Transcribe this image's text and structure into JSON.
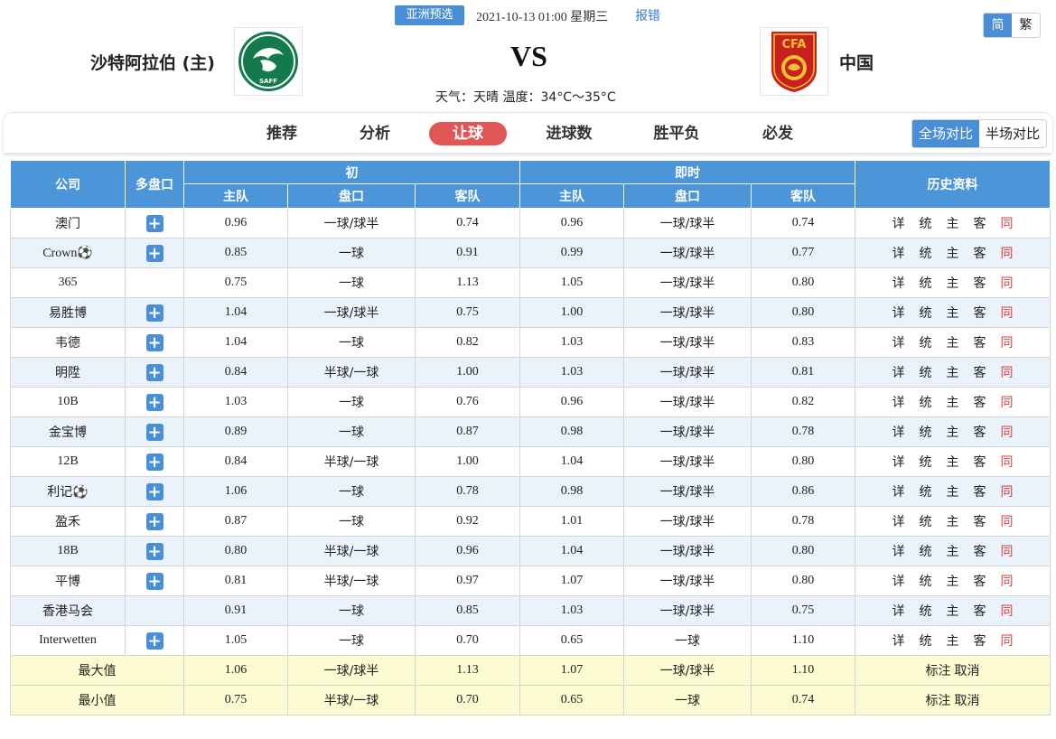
{
  "match": {
    "league": "亚洲预选",
    "datetime": "2021-10-13 01:00 星期三",
    "report": "报错",
    "home": "沙特阿拉伯 (主)",
    "away": "中国",
    "vs": "VS",
    "weather": "天气：天晴  温度：34°C～35°C",
    "home_logo_text": "SAFF",
    "away_logo_text": "CFA"
  },
  "lang": {
    "simplified": "简",
    "traditional": "繁"
  },
  "tabs": [
    "推荐",
    "分析",
    "让球",
    "进球数",
    "胜平负",
    "必发"
  ],
  "active_tab": "让球",
  "compare": {
    "full": "全场对比",
    "half": "半场对比"
  },
  "table": {
    "headers": {
      "company": "公司",
      "multi": "多盘口",
      "initial": "初",
      "live": "即时",
      "history": "历史资料",
      "home": "主队",
      "line": "盘口",
      "away": "客队"
    },
    "history_links": [
      "详",
      "统",
      "主",
      "客",
      "同"
    ],
    "rows": [
      {
        "company": "澳门",
        "plus": true,
        "i_home": "0.96",
        "i_line": "一球/球半",
        "i_away": "0.74",
        "l_home": "0.96",
        "l_line": "一球/球半",
        "l_away": "0.74"
      },
      {
        "company": "Crown⚽",
        "plus": true,
        "i_home": "0.85",
        "i_line": "一球",
        "i_away": "0.91",
        "l_home": "0.99",
        "l_line": "一球/球半",
        "l_away": "0.77"
      },
      {
        "company": "365",
        "plus": false,
        "i_home": "0.75",
        "i_line": "一球",
        "i_away": "1.13",
        "l_home": "1.05",
        "l_line": "一球/球半",
        "l_away": "0.80"
      },
      {
        "company": "易胜博",
        "plus": true,
        "i_home": "1.04",
        "i_line": "一球/球半",
        "i_away": "0.75",
        "l_home": "1.00",
        "l_line": "一球/球半",
        "l_away": "0.80"
      },
      {
        "company": "韦德",
        "plus": true,
        "i_home": "1.04",
        "i_line": "一球",
        "i_away": "0.82",
        "l_home": "1.03",
        "l_line": "一球/球半",
        "l_away": "0.83"
      },
      {
        "company": "明陞",
        "plus": true,
        "i_home": "0.84",
        "i_line": "半球/一球",
        "i_away": "1.00",
        "l_home": "1.03",
        "l_line": "一球/球半",
        "l_away": "0.81"
      },
      {
        "company": "10B",
        "plus": true,
        "i_home": "1.03",
        "i_line": "一球",
        "i_away": "0.76",
        "l_home": "0.96",
        "l_line": "一球/球半",
        "l_away": "0.82"
      },
      {
        "company": "金宝博",
        "plus": true,
        "i_home": "0.89",
        "i_line": "一球",
        "i_away": "0.87",
        "l_home": "0.98",
        "l_line": "一球/球半",
        "l_away": "0.78"
      },
      {
        "company": "12B",
        "plus": true,
        "i_home": "0.84",
        "i_line": "半球/一球",
        "i_away": "1.00",
        "l_home": "1.04",
        "l_line": "一球/球半",
        "l_away": "0.80"
      },
      {
        "company": "利记⚽",
        "plus": true,
        "i_home": "1.06",
        "i_line": "一球",
        "i_away": "0.78",
        "l_home": "0.98",
        "l_line": "一球/球半",
        "l_away": "0.86"
      },
      {
        "company": "盈禾",
        "plus": true,
        "i_home": "0.87",
        "i_line": "一球",
        "i_away": "0.92",
        "l_home": "1.01",
        "l_line": "一球/球半",
        "l_away": "0.78"
      },
      {
        "company": "18B",
        "plus": true,
        "i_home": "0.80",
        "i_line": "半球/一球",
        "i_away": "0.96",
        "l_home": "1.04",
        "l_line": "一球/球半",
        "l_away": "0.80"
      },
      {
        "company": "平博",
        "plus": true,
        "i_home": "0.81",
        "i_line": "半球/一球",
        "i_away": "0.97",
        "l_home": "1.07",
        "l_line": "一球/球半",
        "l_away": "0.80"
      },
      {
        "company": "香港马会",
        "plus": false,
        "i_home": "0.91",
        "i_line": "一球",
        "i_away": "0.85",
        "l_home": "1.03",
        "l_line": "一球/球半",
        "l_away": "0.75"
      },
      {
        "company": "Interwetten",
        "plus": true,
        "i_home": "1.05",
        "i_line": "一球",
        "i_away": "0.70",
        "l_home": "0.65",
        "l_line": "一球",
        "l_away": "1.10"
      }
    ],
    "summary": [
      {
        "label": "最大值",
        "i_home": "1.06",
        "i_line": "一球/球半",
        "i_away": "1.13",
        "l_home": "1.07",
        "l_line": "一球/球半",
        "l_away": "1.10"
      },
      {
        "label": "最小值",
        "i_home": "0.75",
        "i_line": "半球/一球",
        "i_away": "0.70",
        "l_home": "0.65",
        "l_line": "一球",
        "l_away": "0.74"
      }
    ],
    "summary_actions": {
      "mark": "标注",
      "cancel": "取消"
    }
  },
  "colors": {
    "header_blue": "#4d95d9",
    "active_tab_red": "#e05555",
    "alt_row": "#eaf2fb",
    "summary_row": "#fdfbd2",
    "history_same": "#e03a3a"
  }
}
